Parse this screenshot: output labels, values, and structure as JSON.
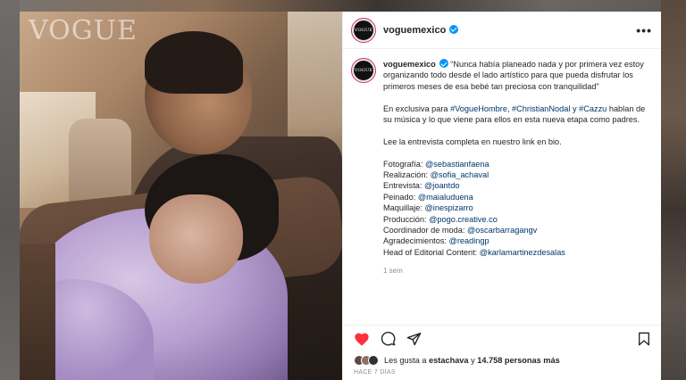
{
  "photo": {
    "watermark": "VOGUE"
  },
  "header": {
    "username": "voguemexico",
    "avatar_text": "VOGUE",
    "more_icon": "more-horizontal-icon"
  },
  "caption": {
    "username": "voguemexico",
    "intro": "“Nunca había planeado nada y por primera vez estoy organizando todo desde el lado artístico para que pueda disfrutar los primeros meses de esa bebé tan preciosa con tranquilidad”",
    "para2_prefix": "En exclusiva para ",
    "tag1": "#VogueHombre",
    "sep1": ", ",
    "tag2": "#ChristianNodal",
    "sep2": " y ",
    "tag3": "#Cazzu",
    "para2_suffix": " hablan de su música y lo que viene para ellos en esta nueva etapa como padres.",
    "para3": "Lee la entrevista completa en nuestro link en bio.",
    "credits": [
      {
        "label": "Fotografía: ",
        "handle": "@sebastianfaena"
      },
      {
        "label": "Realización: ",
        "handle": "@sofia_achaval"
      },
      {
        "label": "Entrevista: ",
        "handle": "@joantdo"
      },
      {
        "label": "Peinado: ",
        "handle": "@maialuduena"
      },
      {
        "label": "Maquillaje: ",
        "handle": "@inespizarro"
      },
      {
        "label": "Producción: ",
        "handle": "@pogo.creative.co"
      },
      {
        "label": "Coordinador de moda: ",
        "handle": "@oscarbarragangv"
      },
      {
        "label": "Agradecimientos: ",
        "handle": "@readingp"
      },
      {
        "label": "Head of Editorial Content: ",
        "handle": "@karlamartinezdesalas"
      }
    ],
    "time_ago": "1 sem"
  },
  "likes": {
    "prefix": "Les gusta a ",
    "user": "estachava",
    "middle": " y ",
    "count": "14.758 personas más"
  },
  "date": "HACE 7 DÍAS",
  "colors": {
    "liked": "#ff3040",
    "link": "#00376b",
    "verified": "#0095f6"
  }
}
